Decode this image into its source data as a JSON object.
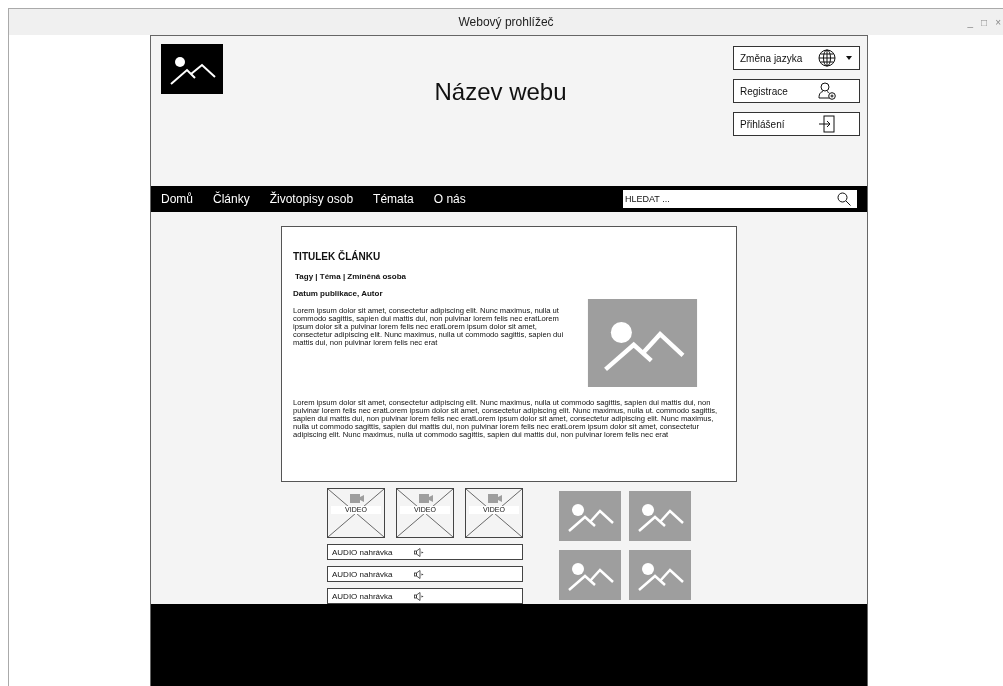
{
  "window": {
    "title": "Webový prohlížeč",
    "controls": [
      "_",
      "□",
      "×"
    ]
  },
  "header": {
    "site_name": "Název webu",
    "buttons": [
      {
        "kind": "language",
        "label": "Změna jazyka"
      },
      {
        "kind": "register",
        "label": "Registrace"
      },
      {
        "kind": "login",
        "label": "Přihlášení"
      }
    ]
  },
  "nav": {
    "items": [
      "Domů",
      "Články",
      "Životopisy osob",
      "Témata",
      "O nás"
    ],
    "search": {
      "placeholder": "HLEDAT ..."
    }
  },
  "article": {
    "title": "TITULEK ČLÁNKU",
    "meta": "Tagy | Téma | Zmíněná osoba",
    "byline": "Datum publikace, Autor",
    "image": {
      "kind": "image"
    },
    "paragraphs": [
      "Lorem ipsum dolor sit amet, consectetur adipiscing elit. Nunc maximus, nulla ut commodo sagittis, sapien dui mattis dui, non pulvinar lorem felis nec eratLorem ipsum dolor sit a pulvinar lorem felis nec eratLorem ipsum dolor sit amet, consectetur adipiscing elit. Nunc maximus, nulla ut commodo sagittis, sapien dui mattis dui, non pulvinar lorem felis nec erat",
      "Lorem ipsum dolor sit amet, consectetur adipiscing elit. Nunc maximus, nulla ut commodo sagittis, sapien dui mattis dui, non pulvinar lorem felis nec eratLorem ipsum dolor sit amet, consectetur adipiscing elit. Nunc maximus, nulla ut. commodo sagittis, sapien dui mattis dui, non pulvinar lorem felis nec eratLorem ipsum dolor sit amet, consectetur adipiscing elit. Nunc maximus, nulla ut commodo sagittis, sapien dui mattis dui, non pulvinar lorem felis nec eratLorem ipsum dolor sit amet, consectetur adipiscing elit. Nunc maximus, nulla ut commodo sagittis, sapien dui mattis dui, non pulvinar lorem felis nec erat"
    ]
  },
  "videos": [
    {
      "label": "VIDEO"
    },
    {
      "label": "VIDEO"
    },
    {
      "label": "VIDEO"
    }
  ],
  "audio": [
    {
      "label": "AUDIO nahrávka"
    },
    {
      "label": "AUDIO nahrávka"
    },
    {
      "label": "AUDIO nahrávka"
    }
  ],
  "gallery": [
    {
      "kind": "image"
    },
    {
      "kind": "image"
    },
    {
      "kind": "image"
    },
    {
      "kind": "image"
    }
  ]
}
